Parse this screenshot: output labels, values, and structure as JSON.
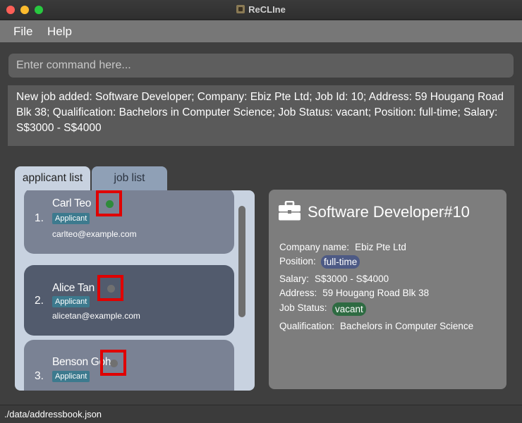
{
  "window": {
    "title": "ReCLIne"
  },
  "menu": {
    "file": "File",
    "help": "Help"
  },
  "command": {
    "placeholder": "Enter command here...",
    "value": ""
  },
  "result": {
    "text": "New job added: Software Developer; Company: Ebiz Pte Ltd; Job Id: 10; Address: 59 Hougang Road Blk 38; Qualification: Bachelors in Computer Science; Job Status: vacant; Position: full-time; Salary: S$3000 - S$4000"
  },
  "tabs": [
    {
      "label": "applicant list",
      "selected": true
    },
    {
      "label": "job list",
      "selected": false
    }
  ],
  "applicants": [
    {
      "index": "1.",
      "name": "Carl Teo",
      "role": "Applicant",
      "email": "carlteo@example.com",
      "status_color": "#2e8b3a",
      "highlighted": true
    },
    {
      "index": "2.",
      "name": "Alice Tan",
      "role": "Applicant",
      "email": "alicetan@example.com",
      "status_color": "#707070",
      "highlighted": true
    },
    {
      "index": "3.",
      "name": "Benson Goh",
      "role": "Applicant",
      "email": "",
      "status_color": "#707070",
      "highlighted": true
    }
  ],
  "job": {
    "title": "Software Developer#10",
    "icon": "briefcase-icon",
    "company_label": "Company name:",
    "company": "Ebiz Pte Ltd",
    "position_label": "Position:",
    "position": "full-time",
    "salary_label": "Salary:",
    "salary": "S$3000 - S$4000",
    "address_label": "Address:",
    "address": "59 Hougang Road Blk 38",
    "status_label": "Job Status:",
    "status": "vacant",
    "qualification_label": "Qualification:",
    "qualification": "Bachelors in Computer Science"
  },
  "statusbar": {
    "path": "./data/addressbook.json"
  }
}
